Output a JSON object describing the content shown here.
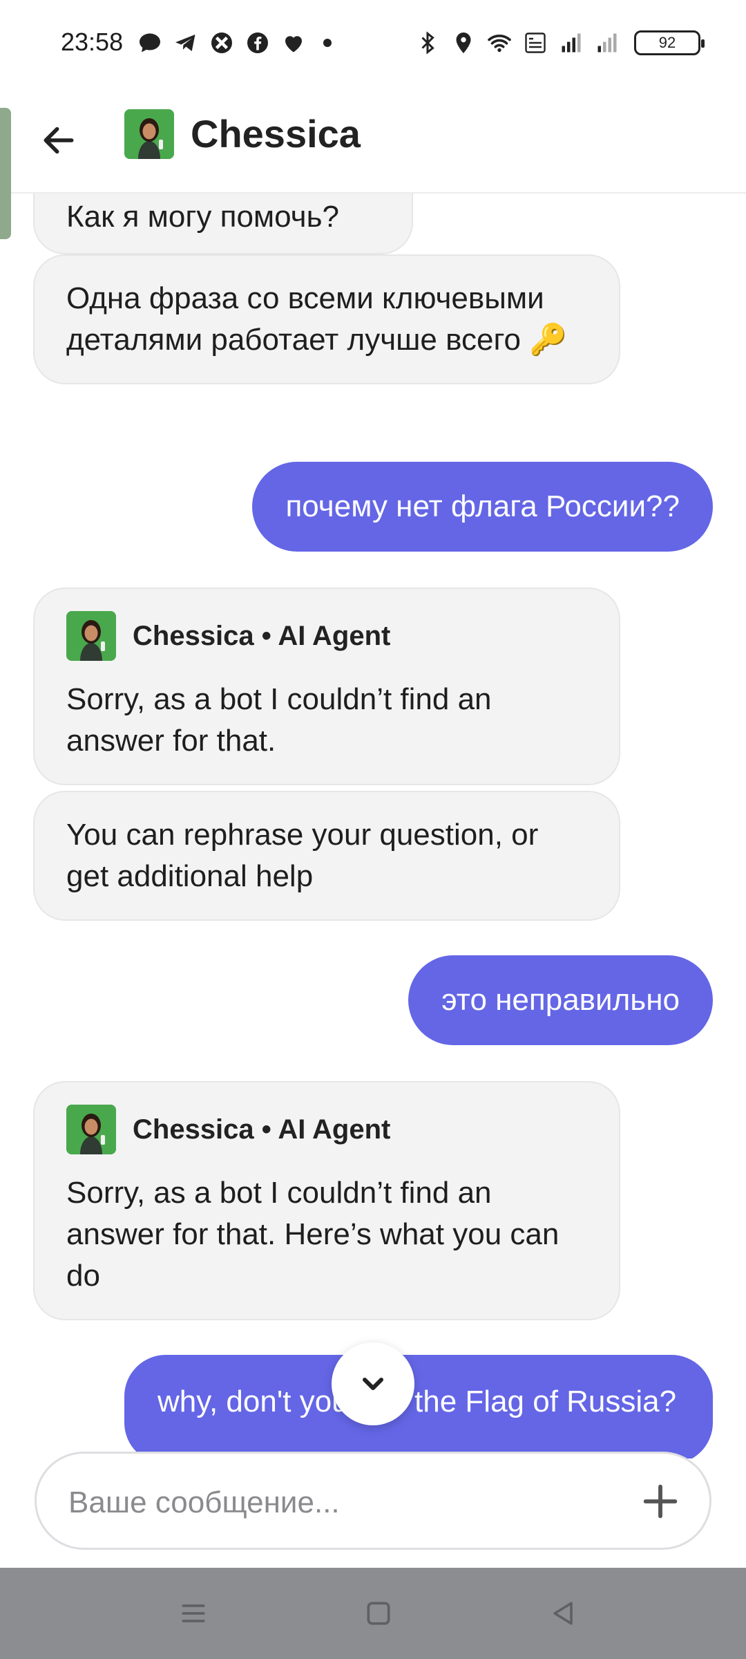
{
  "status_bar": {
    "time": "23:58",
    "notification_icons": [
      "chat-bubble-icon",
      "telegram-icon",
      "app-icon",
      "facebook-icon",
      "heart-icon"
    ],
    "system_icons": [
      "bluetooth-icon",
      "location-icon",
      "wifi-icon",
      "volte-icon",
      "signal-icon",
      "signal-weak-icon"
    ],
    "battery_level": "92"
  },
  "header": {
    "title": "Chessica"
  },
  "messages": [
    {
      "from": "bot",
      "text": "Как я могу помочь?"
    },
    {
      "from": "bot",
      "text": "Одна фраза со всеми ключевыми деталями работает лучше всего 🔑"
    },
    {
      "from": "user",
      "text": "почему нет флага России??"
    },
    {
      "from": "bot",
      "sender": "Chessica • AI Agent",
      "text": "Sorry, as a bot I couldn’t find an answer for that."
    },
    {
      "from": "bot",
      "text": "You can rephrase your question, or get additional help"
    },
    {
      "from": "user",
      "text": "это неправильно"
    },
    {
      "from": "bot",
      "sender": "Chessica • AI Agent",
      "text": "Sorry, as a bot I couldn’t find an answer for that. Here’s what you can do"
    },
    {
      "from": "user",
      "text": "why, don't you see the Flag of Russia?"
    }
  ],
  "composer": {
    "placeholder": "Ваше сообщение...",
    "value": ""
  },
  "colors": {
    "user_bubble": "#6466e6",
    "bot_bubble": "#f3f3f4",
    "nav_bar": "#8c8d91"
  }
}
